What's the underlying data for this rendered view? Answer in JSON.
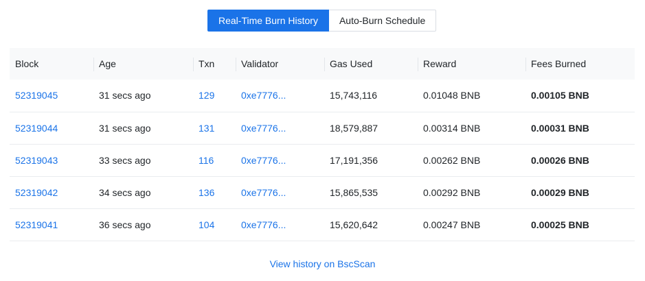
{
  "tabs": [
    {
      "label": "Real-Time Burn History",
      "active": true
    },
    {
      "label": "Auto-Burn Schedule",
      "active": false
    }
  ],
  "table": {
    "headers": [
      "Block",
      "Age",
      "Txn",
      "Validator",
      "Gas Used",
      "Reward",
      "Fees Burned"
    ],
    "rows": [
      {
        "block": "52319045",
        "age": "31 secs ago",
        "txn": "129",
        "validator": "0xe7776...",
        "gas_used": "15,743,116",
        "reward": "0.01048 BNB",
        "fees_burned": "0.00105 BNB"
      },
      {
        "block": "52319044",
        "age": "31 secs ago",
        "txn": "131",
        "validator": "0xe7776...",
        "gas_used": "18,579,887",
        "reward": "0.00314 BNB",
        "fees_burned": "0.00031 BNB"
      },
      {
        "block": "52319043",
        "age": "33 secs ago",
        "txn": "116",
        "validator": "0xe7776...",
        "gas_used": "17,191,356",
        "reward": "0.00262 BNB",
        "fees_burned": "0.00026 BNB"
      },
      {
        "block": "52319042",
        "age": "34 secs ago",
        "txn": "136",
        "validator": "0xe7776...",
        "gas_used": "15,865,535",
        "reward": "0.00292 BNB",
        "fees_burned": "0.00029 BNB"
      },
      {
        "block": "52319041",
        "age": "36 secs ago",
        "txn": "104",
        "validator": "0xe7776...",
        "gas_used": "15,620,642",
        "reward": "0.00247 BNB",
        "fees_burned": "0.00025 BNB"
      }
    ]
  },
  "footer": {
    "link_label": "View history on BscScan"
  },
  "colors": {
    "accent": "#1a73e8",
    "header_bg": "#f8f9fa"
  }
}
